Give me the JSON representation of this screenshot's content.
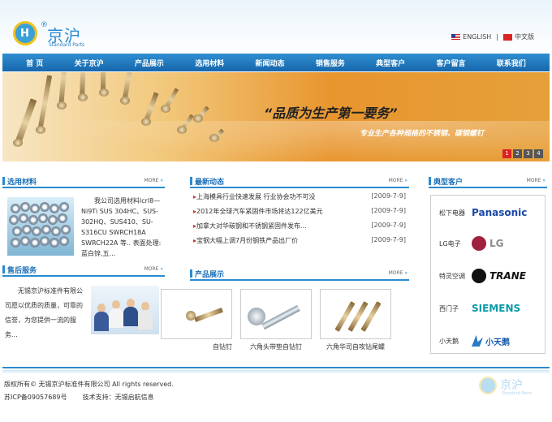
{
  "header": {
    "logo_reg": "®",
    "logo_cn": "京沪",
    "logo_en": "Standard Parts",
    "lang_en": "ENGLISH",
    "lang_sep": "|",
    "lang_cn": "中文版"
  },
  "nav": [
    "首 页",
    "关于京沪",
    "产品展示",
    "选用材料",
    "新闻动态",
    "销售服务",
    "典型客户",
    "客户留言",
    "联系我们"
  ],
  "banner": {
    "slogan": "“品质为生产第一要务”",
    "subslogan": "专业生产各种规格的不锈钢、碳钢螺钉",
    "pages": [
      "1",
      "2",
      "3",
      "4"
    ]
  },
  "more_label": "MORE",
  "materials": {
    "title": "选用材料",
    "text": "我公司选用材料lcrl8—Ni9Ti SUS 304HC、SUS-302HQ、SUS410、SU-S316CU SWRCH18A SWRCH22A 等.. 表面处理:蓝白锌,五..."
  },
  "service": {
    "title": "售后服务",
    "text": "无锡京沪标准件有限公司愿以优质的质量，可靠的信誉，为您提供一流的服务..."
  },
  "news": {
    "title": "最新动态",
    "items": [
      {
        "title": "上海模具行业快速发展 行业协会功不可没",
        "date": "[2009-7-9]"
      },
      {
        "title": "2012年全球汽车紧固件市场将达122亿美元",
        "date": "[2009-7-9]"
      },
      {
        "title": "加拿大对华碳钢和不锈钢紧固件发布...",
        "date": "[2009-7-9]"
      },
      {
        "title": "宝钢大幅上调7月份钢铁产品出厂价",
        "date": "[2009-7-9]"
      }
    ]
  },
  "products": {
    "title": "产品展示",
    "items": [
      "自钻钉",
      "六角头带垫自钻钉",
      "六角华司自攻钻尾螺"
    ]
  },
  "customers": {
    "title": "典型客户",
    "items": [
      {
        "name": "松下电器",
        "logo": "Panasonic",
        "color": "#1a4aa8"
      },
      {
        "name": "LG电子",
        "logo": "LG",
        "color": "#8a1c3a"
      },
      {
        "name": "特灵空调",
        "logo": "TRANE",
        "color": "#111111"
      },
      {
        "name": "西门子",
        "logo": "SIEMENS",
        "color": "#0a9aa8"
      },
      {
        "name": "小天鹅",
        "logo": "小天鹅",
        "color": "#1a5aa8"
      }
    ]
  },
  "footer": {
    "line1": "版权所有© 无锡京沪标准件有限公司  All rights reserved.",
    "icp": "苏ICP备09057689号",
    "support": "技术支持：无锡启航信息"
  }
}
